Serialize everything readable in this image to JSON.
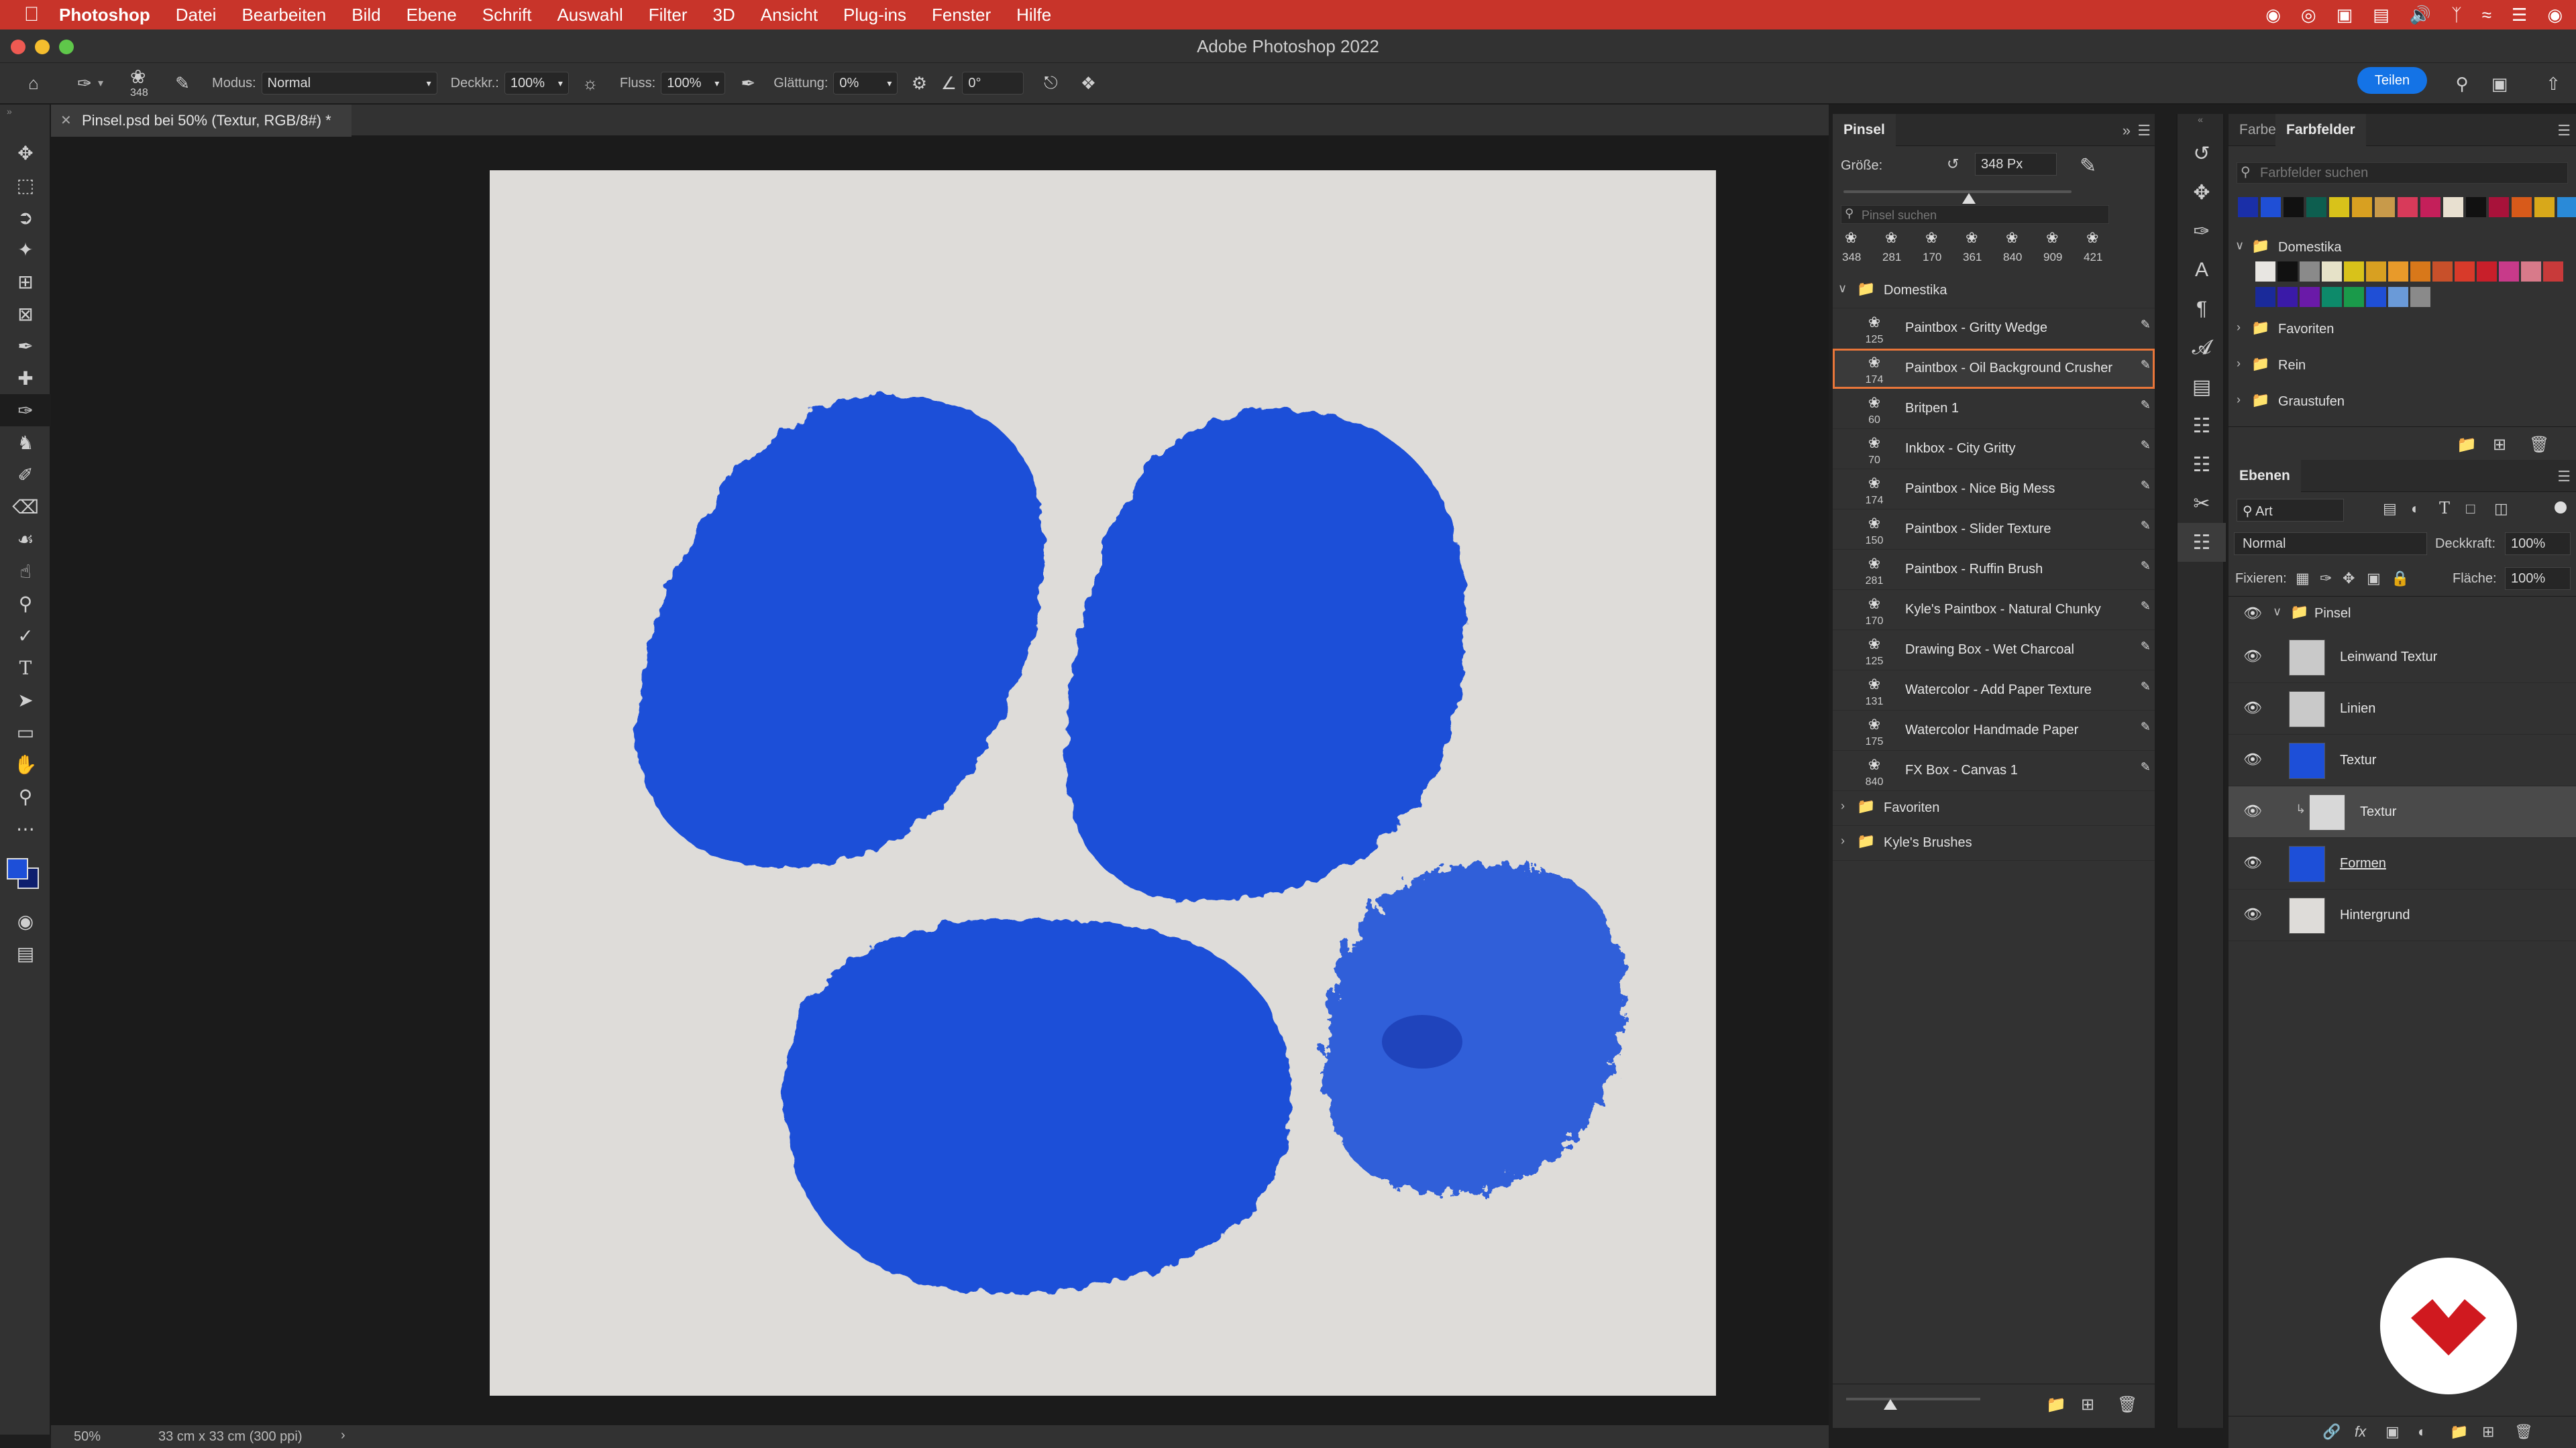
{
  "menubar": {
    "app_name": "Photoshop",
    "items": [
      "Datei",
      "Bearbeiten",
      "Bild",
      "Ebene",
      "Schrift",
      "Auswahl",
      "Filter",
      "3D",
      "Ansicht",
      "Plug-ins",
      "Fenster",
      "Hilfe"
    ]
  },
  "window": {
    "title": "Adobe Photoshop 2022"
  },
  "options_bar": {
    "brush_size": "348",
    "mode_label": "Modus:",
    "mode_value": "Normal",
    "opacity_label": "Deckkr.:",
    "opacity_value": "100%",
    "flow_label": "Fluss:",
    "flow_value": "100%",
    "smoothing_label": "Glättung:",
    "smoothing_value": "0%",
    "angle_value": "0°",
    "share_label": "Teilen"
  },
  "document": {
    "tab_title": "Pinsel.psd bei 50% (Textur, RGB/8#) *",
    "zoom": "50%",
    "info": "33 cm x 33 cm (300 ppi)",
    "paint_color": "#1d4fd8",
    "canvas_color": "#dedcd9"
  },
  "brush_panel": {
    "tab": "Pinsel",
    "size_label": "Größe:",
    "size_value": "348 Px",
    "size_slider": 0.55,
    "search_placeholder": "Pinsel suchen",
    "recent_sizes": [
      "348",
      "281",
      "170",
      "361",
      "840",
      "909",
      "421"
    ],
    "group_open": "Domestika",
    "brushes": [
      {
        "name": "Paintbox - Gritty Wedge",
        "size": "125"
      },
      {
        "name": "Paintbox - Oil Background Crusher",
        "size": "174",
        "selected": true
      },
      {
        "name": "Britpen 1",
        "size": "60"
      },
      {
        "name": "Inkbox - City Gritty",
        "size": "70"
      },
      {
        "name": "Paintbox - Nice Big Mess",
        "size": "174"
      },
      {
        "name": "Paintbox - Slider Texture",
        "size": "150"
      },
      {
        "name": "Paintbox - Ruffin Brush",
        "size": "281"
      },
      {
        "name": "Kyle's Paintbox - Natural Chunky",
        "size": "170"
      },
      {
        "name": "Drawing Box - Wet Charcoal",
        "size": "125"
      },
      {
        "name": "Watercolor - Add Paper Texture",
        "size": "131"
      },
      {
        "name": "Watercolor Handmade Paper",
        "size": "175"
      },
      {
        "name": "FX Box - Canvas 1",
        "size": "840"
      }
    ],
    "closed_groups": [
      "Favoriten",
      "Kyle's Brushes"
    ]
  },
  "swatch_panel": {
    "tabs": [
      "Farbe",
      "Farbfelder"
    ],
    "search_placeholder": "Farbfelder suchen",
    "recent_colors": [
      "#1a2fa8",
      "#1f4fd6",
      "#111111",
      "#0d5e4f",
      "#d8c21a",
      "#d8a021",
      "#c89a4a",
      "#d83a5a",
      "#c41f5a",
      "#e8e0d0",
      "#111111",
      "#a8123a",
      "#d85a1a",
      "#d8a81a",
      "#2a8ad8"
    ],
    "groups": [
      "Domestika",
      "Favoriten",
      "Rein",
      "Graustufen"
    ],
    "domestika_colors": [
      "#e8e6e2",
      "#111111",
      "#8a8a8a",
      "#e6e2c8",
      "#d8c21a",
      "#d8a021",
      "#e89a2a",
      "#d8781a",
      "#c8502a",
      "#d83a2a",
      "#c81f2a",
      "#c83a8a",
      "#d87a8a",
      "#c83a3a",
      "#1a2a9a",
      "#3a1aa8",
      "#6a1aa8",
      "#0d8a6a",
      "#1a9a4a",
      "#1f4fd6",
      "#6a9ad8",
      "#8a8a8a"
    ]
  },
  "layers_panel": {
    "tab": "Ebenen",
    "filter": "Art",
    "blend_mode": "Normal",
    "opacity_label": "Deckkraft:",
    "opacity_value": "100%",
    "lock_label": "Fixieren:",
    "fill_label": "Fläche:",
    "fill_value": "100%",
    "group_name": "Pinsel",
    "layers": [
      {
        "name": "Leinwand Textur"
      },
      {
        "name": "Linien"
      },
      {
        "name": "Textur"
      },
      {
        "name": "Textur"
      },
      {
        "name": "Formen"
      },
      {
        "name": "Hintergrund"
      }
    ]
  }
}
